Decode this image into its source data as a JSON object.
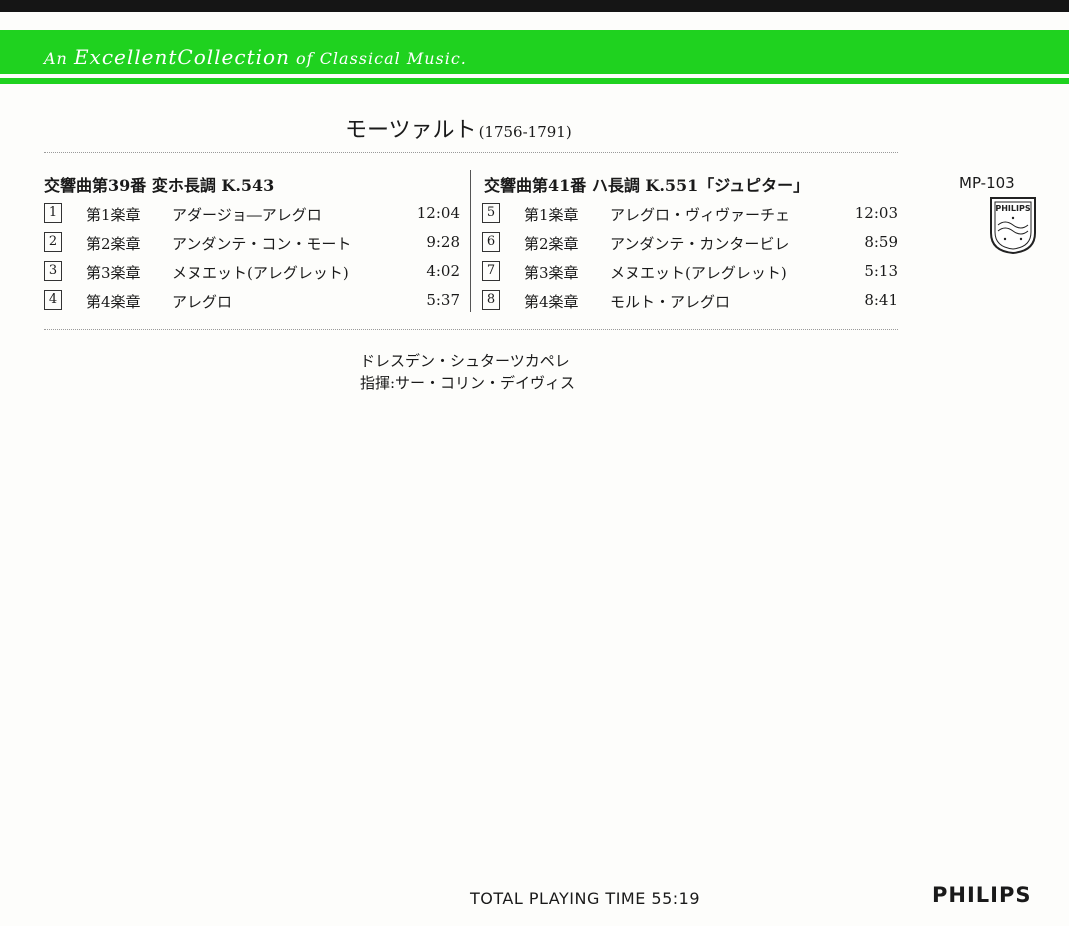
{
  "band": {
    "an": "An",
    "excellent": "Excellent",
    "collection": "Collection",
    "rest": "of Classical Music."
  },
  "composer": {
    "name": "モーツァルト",
    "years": "(1756-1791)"
  },
  "works": [
    {
      "title": "交響曲第39番 変ホ長調 K.543",
      "tracks": [
        {
          "num": "1",
          "movement": "第1楽章",
          "tempo": "アダージョ―アレグロ",
          "time": "12:04"
        },
        {
          "num": "2",
          "movement": "第2楽章",
          "tempo": "アンダンテ・コン・モート",
          "time": "9:28"
        },
        {
          "num": "3",
          "movement": "第3楽章",
          "tempo": "メヌエット(アレグレット)",
          "time": "4:02"
        },
        {
          "num": "4",
          "movement": "第4楽章",
          "tempo": "アレグロ",
          "time": "5:37"
        }
      ]
    },
    {
      "title": "交響曲第41番 ハ長調 K.551「ジュピター」",
      "tracks": [
        {
          "num": "5",
          "movement": "第1楽章",
          "tempo": "アレグロ・ヴィヴァーチェ",
          "time": "12:03"
        },
        {
          "num": "6",
          "movement": "第2楽章",
          "tempo": "アンダンテ・カンタービレ",
          "time": "8:59"
        },
        {
          "num": "7",
          "movement": "第3楽章",
          "tempo": "メヌエット(アレグレット)",
          "time": "5:13"
        },
        {
          "num": "8",
          "movement": "第4楽章",
          "tempo": "モルト・アレグロ",
          "time": "8:41"
        }
      ]
    }
  ],
  "performers": {
    "orchestra": "ドレスデン・シュターツカペレ",
    "conductor": "指揮:サー・コリン・デイヴィス"
  },
  "catalog": "MP-103",
  "logo_text": "PHILIPS",
  "total": "TOTAL PLAYING TIME 55:19",
  "brand": "PHILIPS",
  "colors": {
    "band": "#1fd21f",
    "text": "#1a1a1a"
  }
}
